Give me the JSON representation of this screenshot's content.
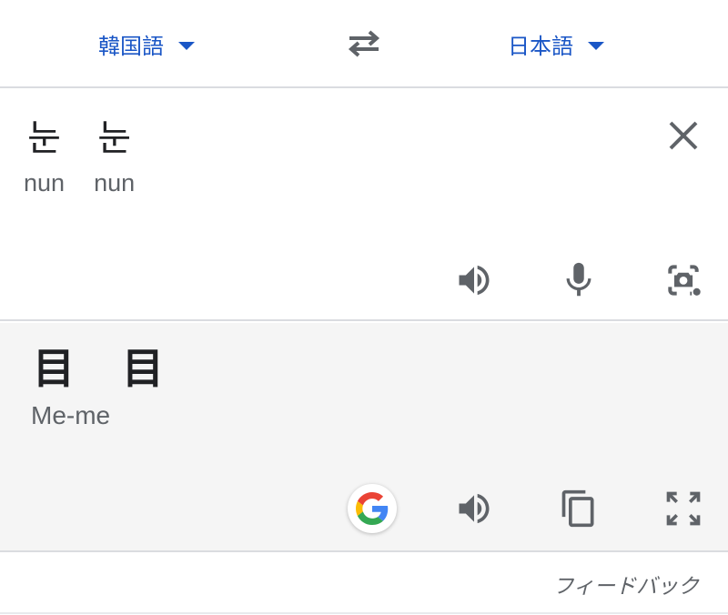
{
  "language_bar": {
    "source_language": "韓国語",
    "target_language": "日本語",
    "swap_icon": "swap-arrows-icon",
    "caret_icon": "caret-down-icon",
    "accent_color": "#1a56c6"
  },
  "source": {
    "words": [
      {
        "text": "눈",
        "romanization": "nun"
      },
      {
        "text": "눈",
        "romanization": "nun"
      }
    ],
    "actions": [
      "speaker-icon",
      "microphone-icon",
      "camera-lens-icon"
    ],
    "clear_icon": "close-icon"
  },
  "target": {
    "words": [
      "目",
      "目"
    ],
    "romanization": "Me-me",
    "actions": [
      "google-icon",
      "speaker-icon",
      "copy-icon",
      "fullscreen-icon"
    ]
  },
  "footer": {
    "feedback_label": "フィードバック"
  }
}
